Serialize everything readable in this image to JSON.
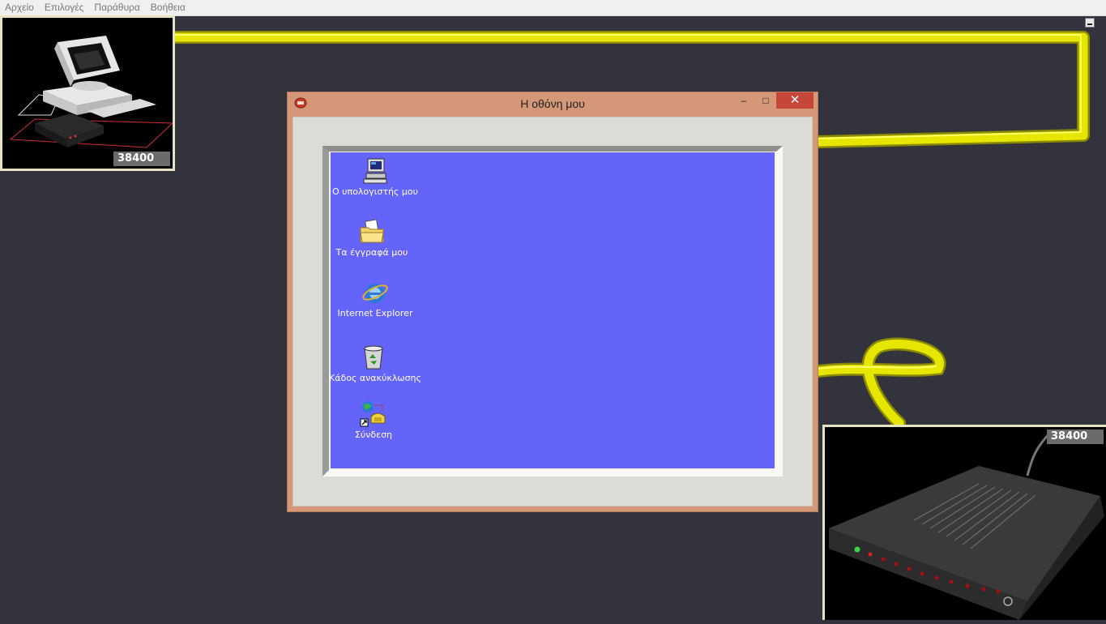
{
  "menubar": {
    "items": [
      {
        "label": "Αρχείο"
      },
      {
        "label": "Επιλογές"
      },
      {
        "label": "Παράθυρα"
      },
      {
        "label": "Βοήθεια"
      }
    ]
  },
  "pc_panel": {
    "speed": "38400"
  },
  "modem_panel": {
    "speed": "38400"
  },
  "window": {
    "title": "Η οθόνη μου",
    "minimize": "–",
    "maximize": "□",
    "close": "✕"
  },
  "desktop": {
    "icons": [
      {
        "label": "Ο υπολογιστής μου",
        "icon": "my-computer-icon"
      },
      {
        "label": "Τα έγγραφά μου",
        "icon": "my-documents-icon"
      },
      {
        "label": "Internet Explorer",
        "icon": "internet-explorer-icon"
      },
      {
        "label": "Κάδος ανακύκλωσης",
        "icon": "recycle-bin-icon"
      },
      {
        "label": "Σύνδεση",
        "icon": "dialup-connection-icon"
      }
    ]
  },
  "colors": {
    "background": "#33333d",
    "cable": "#e6e600",
    "window_frame": "#d49878",
    "close_button": "#c7463b",
    "desktop": "#6464fa"
  }
}
